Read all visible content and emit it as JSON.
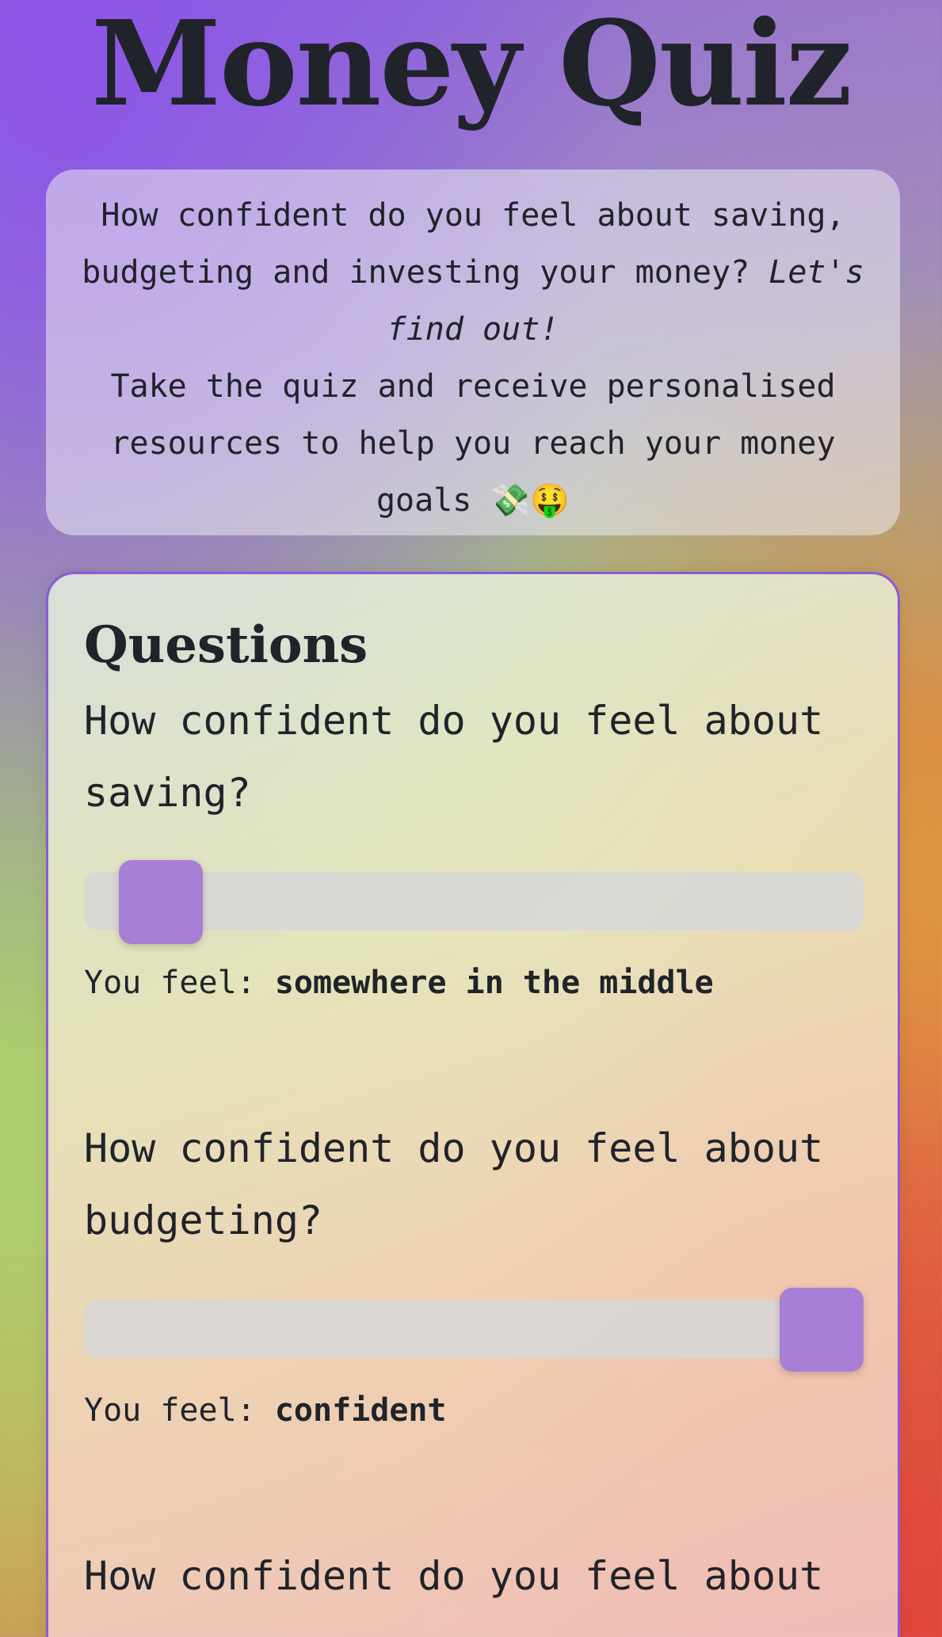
{
  "title": "Money Quiz",
  "intro": {
    "line1": "How confident do you feel about saving,",
    "line2_plain": "budgeting and investing your money?",
    "line2_italic": "Let's",
    "line3_italic": "find out!",
    "line4": "Take the quiz and receive personalised",
    "line5": "resources to help you reach your money",
    "line6": "goals 💸🤑"
  },
  "quiz": {
    "heading": "Questions",
    "feel_prefix": "You feel:",
    "questions": [
      {
        "line1": "How confident do you feel about",
        "line2": "saving?",
        "slider_value": 0.0,
        "feeling": "somewhere in the middle"
      },
      {
        "line1": "How confident do you feel about",
        "line2": "budgeting?",
        "slider_value": 1.0,
        "feeling": "confident"
      },
      {
        "line1": "How confident do you feel about"
      }
    ]
  },
  "colors": {
    "accent": "#a77fd6",
    "panel_border": "#8a5bd6",
    "text": "#20232a"
  }
}
